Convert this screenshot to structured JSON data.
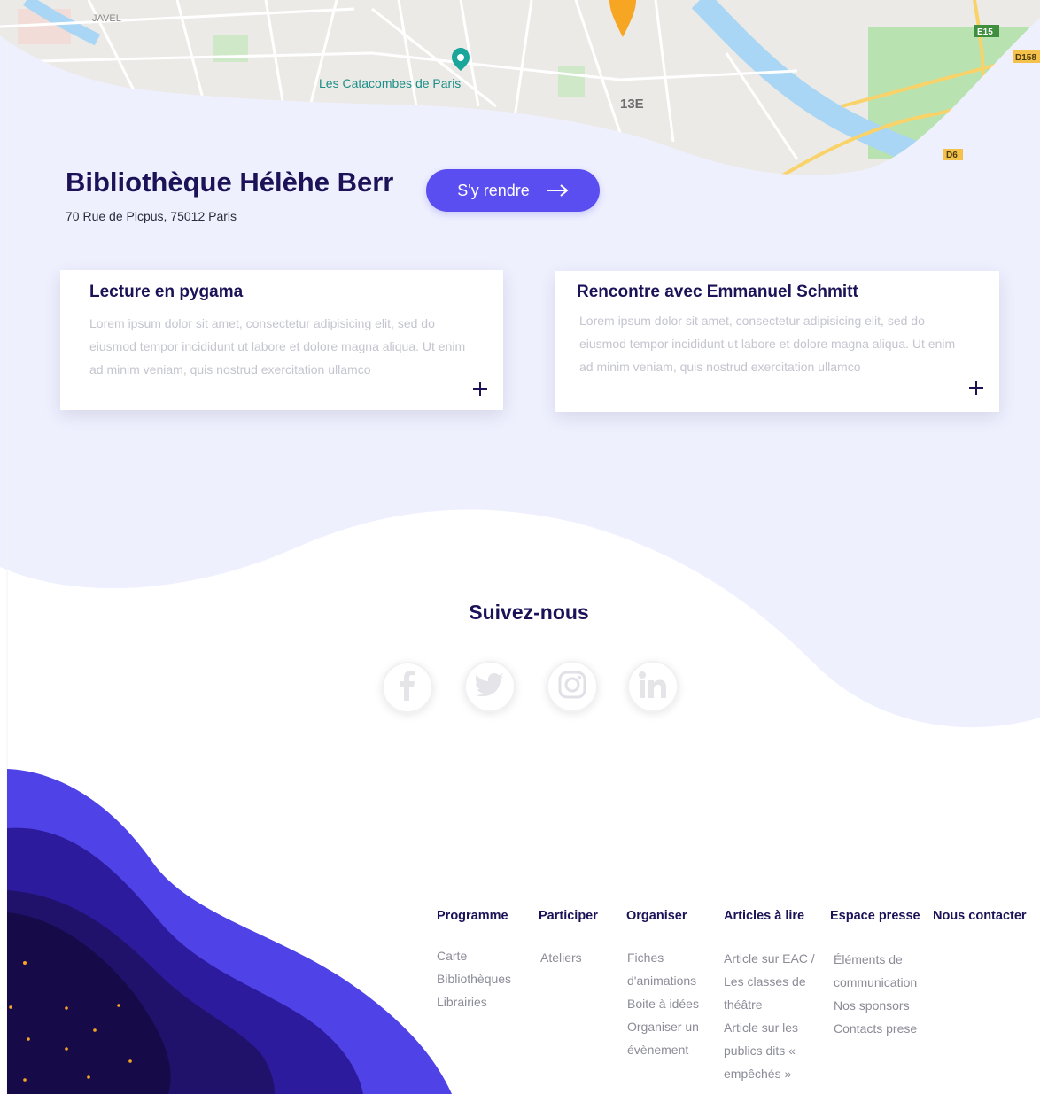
{
  "map": {
    "labels": {
      "district_javel": "JAVEL",
      "poi_catacombes": "Les Catacombes de Paris",
      "district_13e": "13E",
      "road_e15": "E15",
      "road_d158": "D158",
      "road_d6": "D6"
    },
    "colors": {
      "marker": "#f6a623",
      "poi": "#1aa69a",
      "river": "#a9d6f5",
      "park": "#b9e2b1",
      "road": "#f9d36a"
    }
  },
  "library": {
    "name": "Bibliothèque Hélèhe Berr",
    "address": "70 Rue de Picpus, 75012 Paris",
    "cta_label": "S'y rendre"
  },
  "events": [
    {
      "title": "Lecture en pygama",
      "description": "Lorem ipsum dolor sit amet, consectetur adipisicing elit, sed do eiusmod tempor incididunt ut labore et dolore magna aliqua. Ut enim ad minim veniam, quis nostrud exercitation ullamco",
      "more": "+"
    },
    {
      "title": "Rencontre avec Emmanuel Schmitt",
      "description": "Lorem ipsum dolor sit amet, consectetur adipisicing elit, sed do eiusmod tempor incididunt ut labore et dolore magna aliqua. Ut enim ad minim veniam, quis nostrud exercitation ullamco",
      "more": "+"
    }
  ],
  "social": {
    "title": "Suivez-nous",
    "networks": [
      "facebook-icon",
      "twitter-icon",
      "instagram-icon",
      "linkedin-icon"
    ]
  },
  "footer": {
    "columns": [
      {
        "heading": "Programme",
        "links": [
          "Carte",
          "Bibliothèques",
          "Librairies"
        ]
      },
      {
        "heading": "Participer",
        "links": [
          "Ateliers"
        ]
      },
      {
        "heading": "Organiser",
        "links": [
          "Fiches d'animations",
          "Boite à idées",
          "Organiser un évènement"
        ]
      },
      {
        "heading": "Articles à lire",
        "links": [
          "Article sur EAC / Les classes de théâtre",
          "Article sur les publics dits « empêchés »"
        ]
      },
      {
        "heading": "Espace presse",
        "links": [
          "Éléments de communication",
          "Nos sponsors",
          "Contacts prese"
        ]
      },
      {
        "heading": "Nous contacter",
        "links": []
      }
    ]
  },
  "colors": {
    "accent": "#5b4ef0",
    "navy": "#1b1257",
    "pale_background": "#eef0fe",
    "wave_1": "#4f43e8",
    "wave_2": "#2d1b9e",
    "wave_3": "#20116b",
    "wave_4": "#170a49",
    "dots": "#f6a623"
  }
}
